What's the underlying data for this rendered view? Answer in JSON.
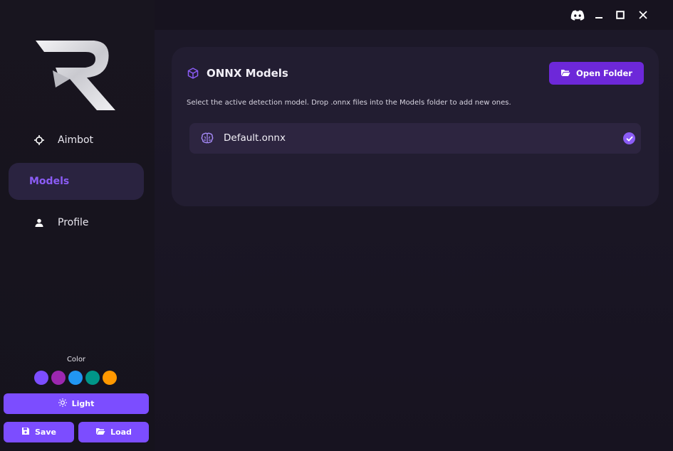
{
  "window": {
    "controls": [
      "discord-icon",
      "minimize-icon",
      "maximize-icon",
      "close-icon"
    ]
  },
  "sidebar": {
    "items": [
      {
        "label": "Aimbot",
        "icon": "crosshair-icon"
      },
      {
        "label": "Models",
        "active": true
      },
      {
        "label": "Profile",
        "icon": "person-icon"
      }
    ],
    "color_label": "Color",
    "swatches": [
      "#7c4dff",
      "#9c27b0",
      "#2196f3",
      "#009688",
      "#ff9800"
    ],
    "light_label": "Light",
    "save_label": "Save",
    "load_label": "Load"
  },
  "card": {
    "title": "ONNX Models",
    "icon": "cube-icon",
    "open_folder_label": "Open Folder",
    "description": "Select the active detection model. Drop .onnx files into the Models folder to add new ones.",
    "models": [
      {
        "name": "Default.onnx",
        "selected": true,
        "icon": "brain-icon"
      }
    ]
  },
  "colors": {
    "accent": "#7c4dff",
    "accent_text": "#8b5cf6",
    "background": "#17131f"
  }
}
